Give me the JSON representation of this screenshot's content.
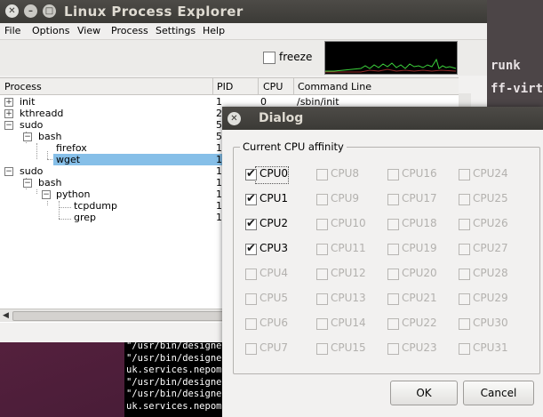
{
  "main_window": {
    "title": "Linux Process Explorer",
    "menu": [
      "File",
      "Options",
      "View",
      "Process",
      "Settings",
      "Help"
    ],
    "freeze_label": "freeze",
    "freeze_checked": false,
    "columns": [
      "Process",
      "PID",
      "CPU",
      "Command Line"
    ],
    "rows": [
      {
        "name": "init",
        "pid": "1",
        "cpu": "0",
        "cmd": "/sbin/init"
      },
      {
        "name": "kthreadd",
        "pid": "2",
        "cpu": "",
        "cmd": ""
      },
      {
        "name": "sudo",
        "pid": "5",
        "cpu": "",
        "cmd": ""
      },
      {
        "name": "bash",
        "pid": "5",
        "cpu": "",
        "cmd": ""
      },
      {
        "name": "firefox",
        "pid": "1",
        "cpu": "",
        "cmd": ""
      },
      {
        "name": "wget",
        "pid": "1",
        "cpu": "",
        "cmd": ""
      },
      {
        "name": "sudo",
        "pid": "1",
        "cpu": "",
        "cmd": ""
      },
      {
        "name": "bash",
        "pid": "1",
        "cpu": "",
        "cmd": ""
      },
      {
        "name": "python",
        "pid": "1",
        "cpu": "",
        "cmd": ""
      },
      {
        "name": "tcpdump",
        "pid": "1",
        "cpu": "",
        "cmd": ""
      },
      {
        "name": "grep",
        "pid": "1",
        "cpu": "",
        "cmd": ""
      }
    ],
    "selected_row": "wget",
    "graph_color": "#3cd23c"
  },
  "background": {
    "right_text": [
      "runk",
      "ff-virtual"
    ],
    "terminal_lines": [
      "\"/usr/bin/designer",
      "\"/usr/bin/designer",
      "uk.services.nepomu",
      "\"/usr/bin/designer",
      "\"/usr/bin/designer",
      "uk.services.nepomu"
    ]
  },
  "dialog": {
    "title": "Dialog",
    "group_label": "Current CPU affinity",
    "cpus": [
      {
        "label": "CPU0",
        "checked": true,
        "enabled": true
      },
      {
        "label": "CPU1",
        "checked": true,
        "enabled": true
      },
      {
        "label": "CPU2",
        "checked": true,
        "enabled": true
      },
      {
        "label": "CPU3",
        "checked": true,
        "enabled": true
      },
      {
        "label": "CPU4",
        "checked": false,
        "enabled": false
      },
      {
        "label": "CPU5",
        "checked": false,
        "enabled": false
      },
      {
        "label": "CPU6",
        "checked": false,
        "enabled": false
      },
      {
        "label": "CPU7",
        "checked": false,
        "enabled": false
      },
      {
        "label": "CPU8",
        "checked": false,
        "enabled": false
      },
      {
        "label": "CPU9",
        "checked": false,
        "enabled": false
      },
      {
        "label": "CPU10",
        "checked": false,
        "enabled": false
      },
      {
        "label": "CPU11",
        "checked": false,
        "enabled": false
      },
      {
        "label": "CPU12",
        "checked": false,
        "enabled": false
      },
      {
        "label": "CPU13",
        "checked": false,
        "enabled": false
      },
      {
        "label": "CPU14",
        "checked": false,
        "enabled": false
      },
      {
        "label": "CPU15",
        "checked": false,
        "enabled": false
      },
      {
        "label": "CPU16",
        "checked": false,
        "enabled": false
      },
      {
        "label": "CPU17",
        "checked": false,
        "enabled": false
      },
      {
        "label": "CPU18",
        "checked": false,
        "enabled": false
      },
      {
        "label": "CPU19",
        "checked": false,
        "enabled": false
      },
      {
        "label": "CPU20",
        "checked": false,
        "enabled": false
      },
      {
        "label": "CPU21",
        "checked": false,
        "enabled": false
      },
      {
        "label": "CPU22",
        "checked": false,
        "enabled": false
      },
      {
        "label": "CPU23",
        "checked": false,
        "enabled": false
      },
      {
        "label": "CPU24",
        "checked": false,
        "enabled": false
      },
      {
        "label": "CPU25",
        "checked": false,
        "enabled": false
      },
      {
        "label": "CPU26",
        "checked": false,
        "enabled": false
      },
      {
        "label": "CPU27",
        "checked": false,
        "enabled": false
      },
      {
        "label": "CPU28",
        "checked": false,
        "enabled": false
      },
      {
        "label": "CPU29",
        "checked": false,
        "enabled": false
      },
      {
        "label": "CPU30",
        "checked": false,
        "enabled": false
      },
      {
        "label": "CPU31",
        "checked": false,
        "enabled": false
      }
    ],
    "ok_label": "OK",
    "cancel_label": "Cancel"
  }
}
